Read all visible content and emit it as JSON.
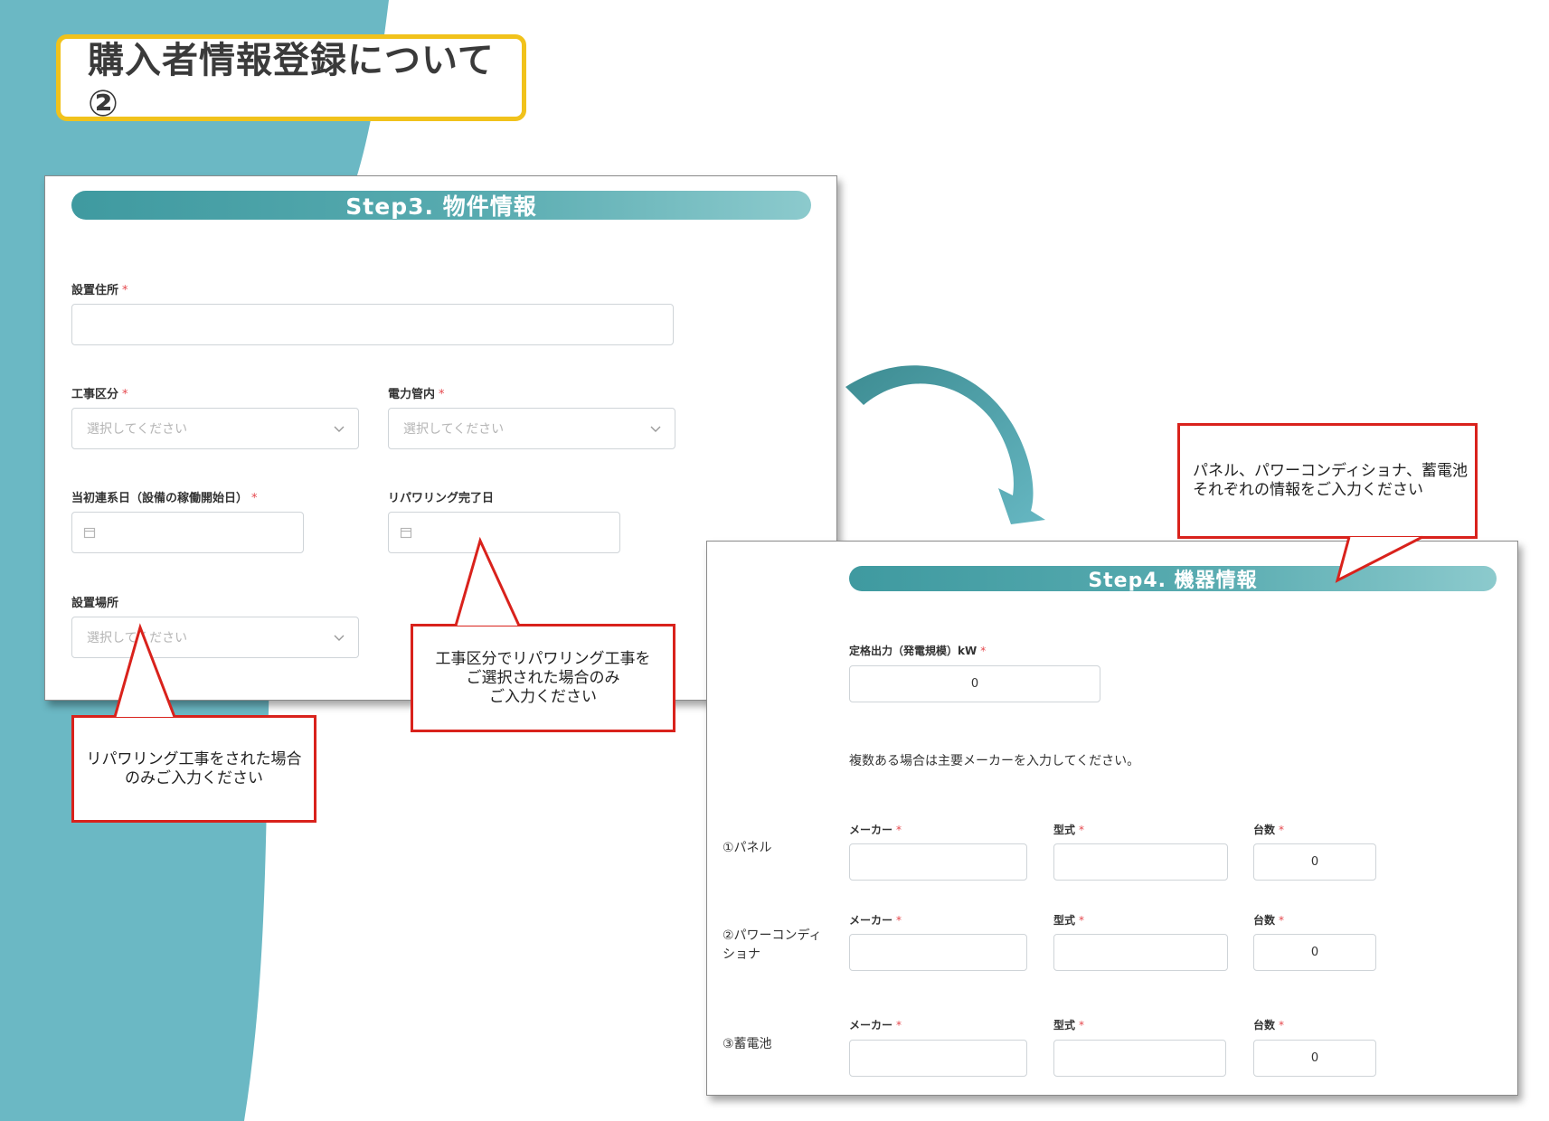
{
  "title": "購入者情報登録について②",
  "colors": {
    "teal": "#6bb8c4",
    "callout_border": "#d9221c",
    "title_border": "#f1c21b",
    "required": "#e5484d"
  },
  "step3": {
    "header": "Step3. 物件情報",
    "address_label": "設置住所",
    "required_mark": "*",
    "work_type_label": "工事区分",
    "work_type_placeholder": "選択してください",
    "power_area_label": "電力管内",
    "power_area_placeholder": "選択してください",
    "initial_date_label": "当初連系日（設備の稼働開始日）",
    "repowering_date_label": "リパワリング完了日",
    "location_label": "設置場所",
    "location_placeholder": "選択してください",
    "icons": {
      "chevron": "chevron-down-icon",
      "calendar": "calendar-icon"
    }
  },
  "step4": {
    "header": "Step4. 機器情報",
    "rated_output_label": "定格出力（発電規模）kW",
    "rated_output_value": "0",
    "note": "複数ある場合は主要メーカーを入力してください。",
    "maker_label": "メーカー",
    "model_label": "型式",
    "count_label": "台数",
    "rows": [
      {
        "label": "①パネル",
        "count": "0"
      },
      {
        "label": "②パワーコンディショナ",
        "count": "0"
      },
      {
        "label": "③蓄電池",
        "count": "0"
      }
    ]
  },
  "callouts": {
    "equipment": "パネル、パワーコンディショナ、蓄電池\nそれぞれの情報をご入力ください",
    "repowering_date": "工事区分でリパワリング工事を\nご選択された場合のみ\nご入力ください",
    "location": "リパワリング工事をされた場合\nのみご入力ください"
  }
}
